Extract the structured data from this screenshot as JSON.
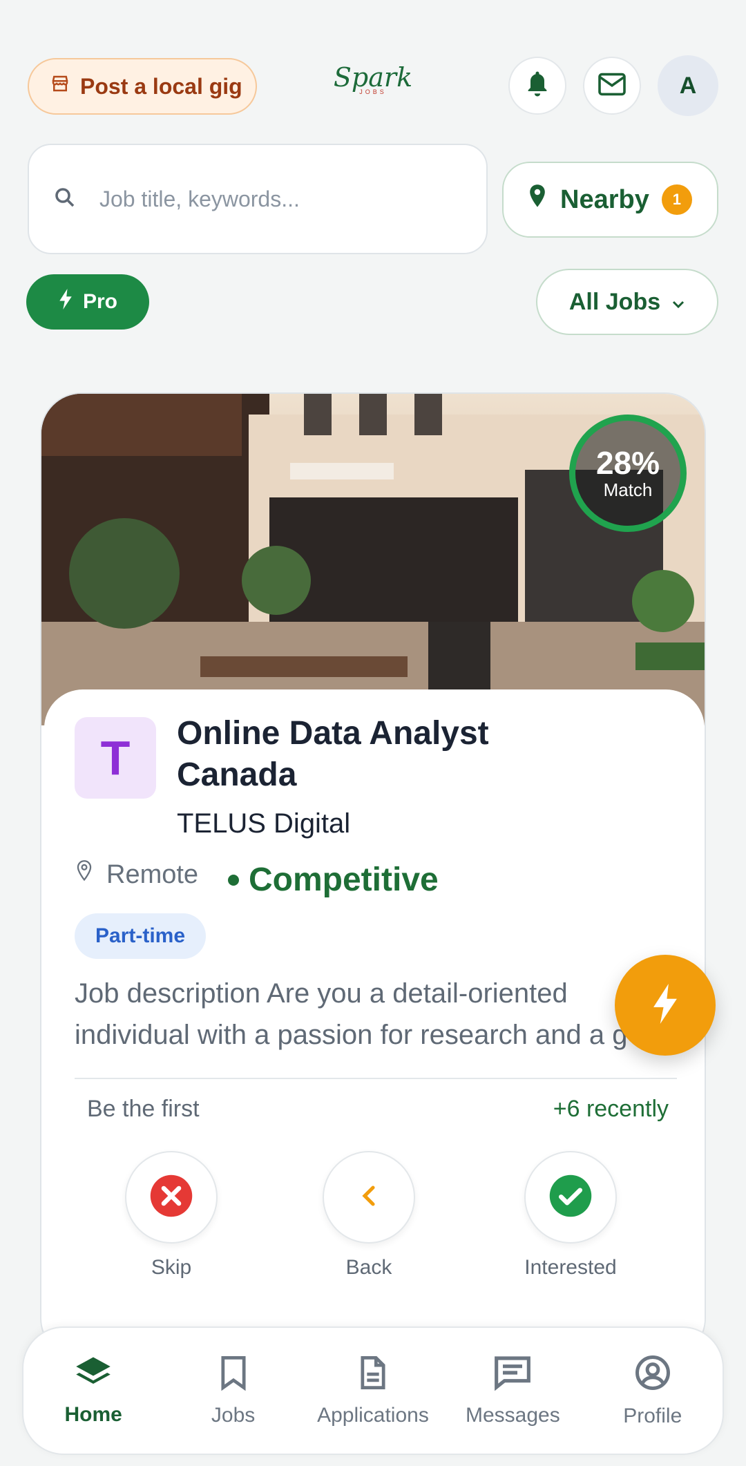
{
  "header": {
    "post_gig_label": "Post a local gig",
    "logo_text": "Spark",
    "logo_sub": "JOBS",
    "avatar_initial": "A"
  },
  "search": {
    "placeholder": "Job title, keywords...",
    "value": ""
  },
  "filters": {
    "nearby_label": "Nearby",
    "nearby_count": "1",
    "pro_label": "Pro",
    "all_jobs_label": "All Jobs"
  },
  "job": {
    "match_percent": "28%",
    "match_label": "Match",
    "company_initial": "T",
    "title": "Online Data Analyst Canada",
    "company": "TELUS Digital",
    "location": "Remote",
    "salary": "Competitive",
    "tag": "Part-time",
    "description": "Job description Are you a detail-oriented individual with a passion for research and a g",
    "applicants_note": "Be the first",
    "recent_note": "+6 recently"
  },
  "actions": {
    "skip_label": "Skip",
    "back_label": "Back",
    "interested_label": "Interested"
  },
  "nav": {
    "home": "Home",
    "jobs": "Jobs",
    "applications": "Applications",
    "messages": "Messages",
    "profile": "Profile"
  },
  "colors": {
    "brand_green": "#1d8a45",
    "accent_orange": "#f29d0c",
    "skip_red": "#e53935",
    "interested_green": "#1f9d4c"
  }
}
